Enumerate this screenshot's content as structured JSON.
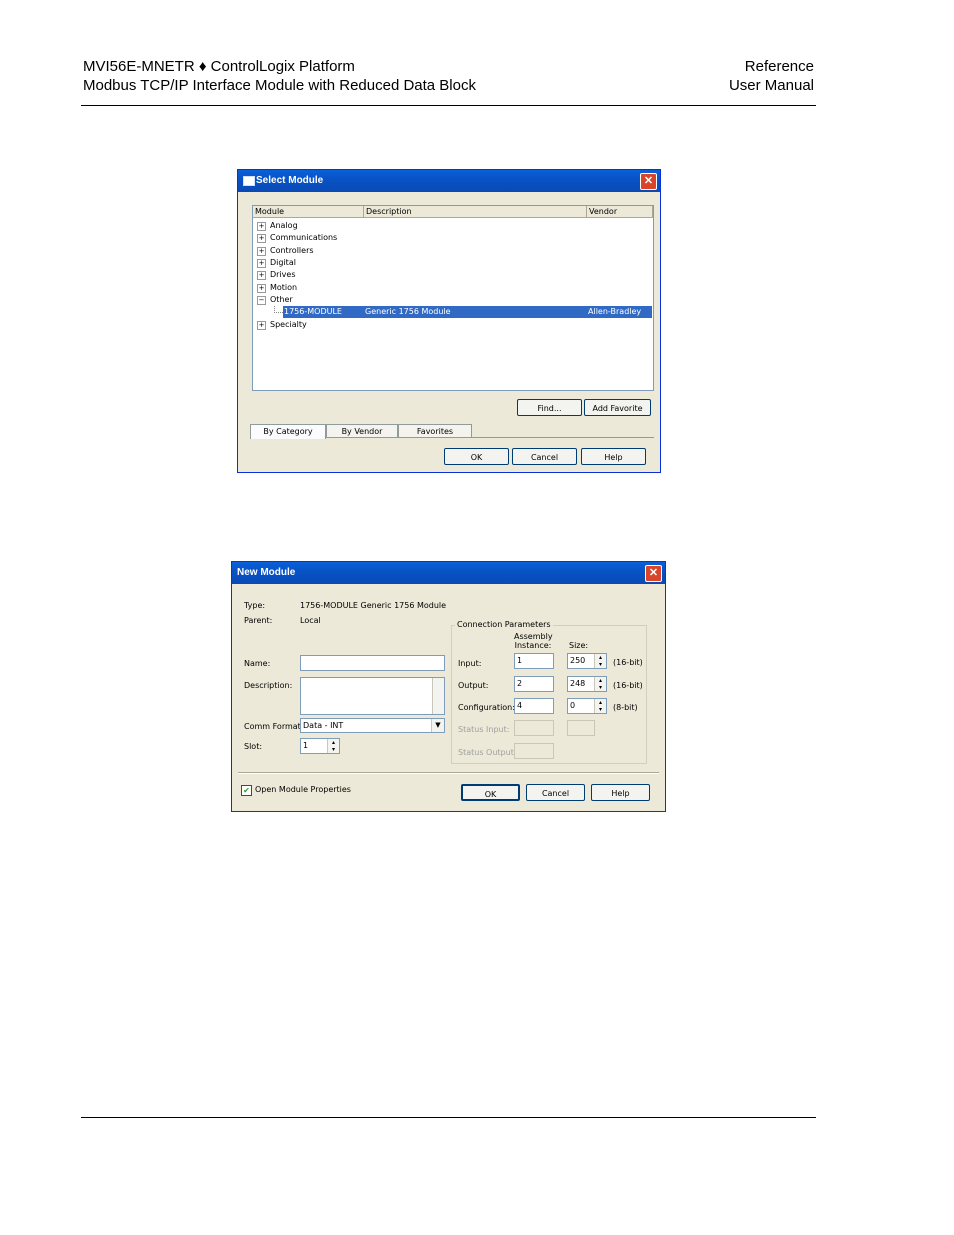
{
  "header": {
    "left_line1": "MVI56E-MNETR ♦ ControlLogix Platform",
    "left_line2": "Modbus TCP/IP Interface Module with Reduced Data Block",
    "right_line1": "Reference",
    "right_line2": "User Manual"
  },
  "select_module": {
    "title": "Select Module",
    "columns": [
      "Module",
      "Description",
      "Vendor"
    ],
    "tree": [
      {
        "label": "Analog",
        "expander": "+"
      },
      {
        "label": "Communications",
        "expander": "+"
      },
      {
        "label": "Controllers",
        "expander": "+"
      },
      {
        "label": "Digital",
        "expander": "+"
      },
      {
        "label": "Drives",
        "expander": "+"
      },
      {
        "label": "Motion",
        "expander": "+"
      },
      {
        "label": "Other",
        "expander": "−"
      },
      {
        "label": "1756-MODULE",
        "description": "Generic 1756 Module",
        "vendor": "Allen-Bradley",
        "selected": true
      },
      {
        "label": "Specialty",
        "expander": "+"
      }
    ],
    "find_button": "Find...",
    "add_favorite_button": "Add Favorite",
    "tabs": [
      "By Category",
      "By Vendor",
      "Favorites"
    ],
    "ok_button": "OK",
    "cancel_button": "Cancel",
    "help_button": "Help"
  },
  "new_module": {
    "title": "New Module",
    "type_label": "Type:",
    "type_value": "1756-MODULE Generic 1756 Module",
    "parent_label": "Parent:",
    "parent_value": "Local",
    "name_label": "Name:",
    "name_value": "",
    "description_label": "Description:",
    "comm_format_label": "Comm Format:",
    "comm_format_value": "Data - INT",
    "slot_label": "Slot:",
    "slot_value": "1",
    "conn_params_title": "Connection Parameters",
    "assembly_instance_header": "Assembly Instance:",
    "size_header": "Size:",
    "rows": [
      {
        "label": "Input:",
        "instance": "1",
        "size": "250",
        "unit": "(16-bit)"
      },
      {
        "label": "Output:",
        "instance": "2",
        "size": "248",
        "unit": "(16-bit)"
      },
      {
        "label": "Configuration:",
        "instance": "4",
        "size": "0",
        "unit": "(8-bit)"
      },
      {
        "label": "Status Input:",
        "instance": "",
        "size": ""
      },
      {
        "label": "Status Output:",
        "instance": ""
      }
    ],
    "open_props_label": "Open Module Properties",
    "open_props_checked": "✔",
    "ok_button": "OK",
    "cancel_button": "Cancel",
    "help_button": "Help"
  }
}
